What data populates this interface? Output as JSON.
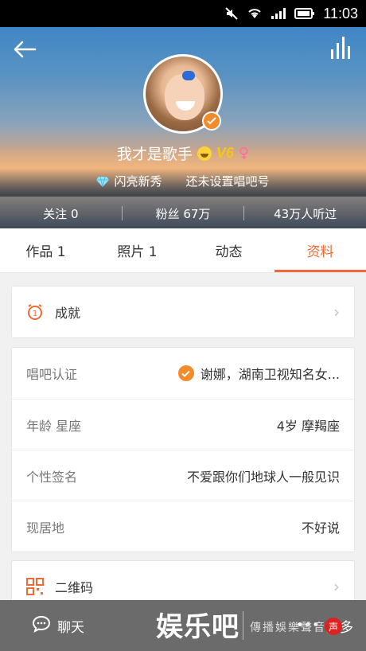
{
  "status_bar": {
    "time": "11:03"
  },
  "profile": {
    "username": "我才是歌手",
    "vip_label": "V6",
    "gender_symbol": "♀",
    "level_text": "闪亮新秀",
    "singbar_id_text": "还未设置唱吧号",
    "following": "关注 0",
    "fans": "粉丝 67万",
    "listens": "43万人听过"
  },
  "tabs": [
    {
      "label": "作品 1"
    },
    {
      "label": "照片 1"
    },
    {
      "label": "动态"
    },
    {
      "label": "资料",
      "active": true
    }
  ],
  "achievement": {
    "label": "成就"
  },
  "info_rows": [
    {
      "label": "唱吧认证",
      "value": "谢娜，湖南卫视知名女..."
    },
    {
      "label": "年龄 星座",
      "value": "4岁 摩羯座"
    },
    {
      "label": "个性签名",
      "value": "不爱跟你们地球人一般见识"
    },
    {
      "label": "现居地",
      "value": "不好说"
    }
  ],
  "qr": {
    "label": "二维码"
  },
  "bottom": {
    "chat_label": "聊天",
    "more_label": "更多"
  },
  "watermark": {
    "main": "娱乐吧",
    "sub": "傳播娛樂聲音",
    "seal": "声"
  },
  "colors": {
    "accent": "#f06a35",
    "badge": "#f28c2b"
  }
}
